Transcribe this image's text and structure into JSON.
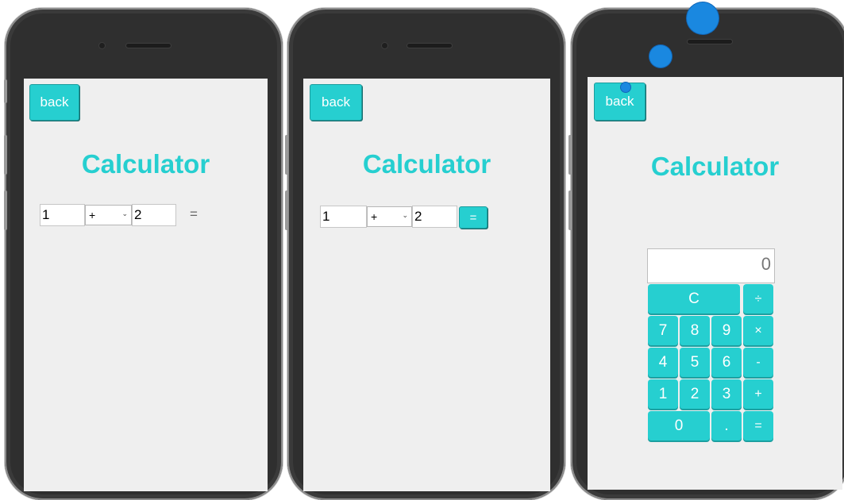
{
  "phones": [
    {
      "back_label": "back",
      "title": "Calculator",
      "operand1": "1",
      "operator": "+",
      "operand2": "2",
      "equals": "="
    },
    {
      "back_label": "back",
      "title": "Calculator",
      "operand1": "1",
      "operator": "+",
      "operand2": "2",
      "equals": "="
    },
    {
      "back_label": "back",
      "title": "Calculator",
      "display": "0",
      "keys": {
        "clear": "C",
        "divide": "÷",
        "k7": "7",
        "k8": "8",
        "k9": "9",
        "multiply": "×",
        "k4": "4",
        "k5": "5",
        "k6": "6",
        "minus": "-",
        "k1": "1",
        "k2": "2",
        "k3": "3",
        "plus": "+",
        "k0": "0",
        "dot": ".",
        "equals": "="
      }
    }
  ],
  "colors": {
    "accent": "#26cfd0",
    "screen_bg": "#efefef",
    "phone_body": "#2f2f2f",
    "touch_indicator": "#1a88e0"
  }
}
